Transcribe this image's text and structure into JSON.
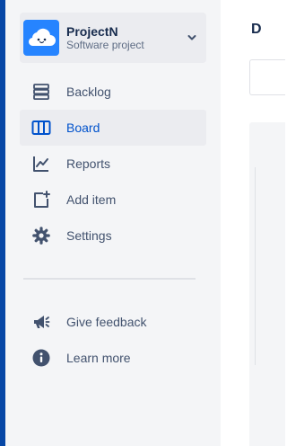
{
  "project": {
    "name": "ProjectN",
    "type": "Software project",
    "avatar_icon": "cloud-avatar-icon",
    "chevron_icon": "chevron-down-icon"
  },
  "nav": {
    "items": [
      {
        "label": "Backlog",
        "icon": "backlog-icon",
        "active": false
      },
      {
        "label": "Board",
        "icon": "board-icon",
        "active": true
      },
      {
        "label": "Reports",
        "icon": "reports-icon",
        "active": false
      },
      {
        "label": "Add item",
        "icon": "add-item-icon",
        "active": false
      },
      {
        "label": "Settings",
        "icon": "gear-icon",
        "active": false
      }
    ],
    "secondary": [
      {
        "label": "Give feedback",
        "icon": "megaphone-icon"
      },
      {
        "label": "Learn more",
        "icon": "info-icon"
      }
    ]
  },
  "main": {
    "title_fragment": "D"
  },
  "colors": {
    "rail": "#0747a6",
    "sidebar_bg": "#f4f5f7",
    "active_bg": "#ebecf0",
    "active_text": "#0052cc",
    "text": "#42526e",
    "avatar": "#2684ff"
  }
}
